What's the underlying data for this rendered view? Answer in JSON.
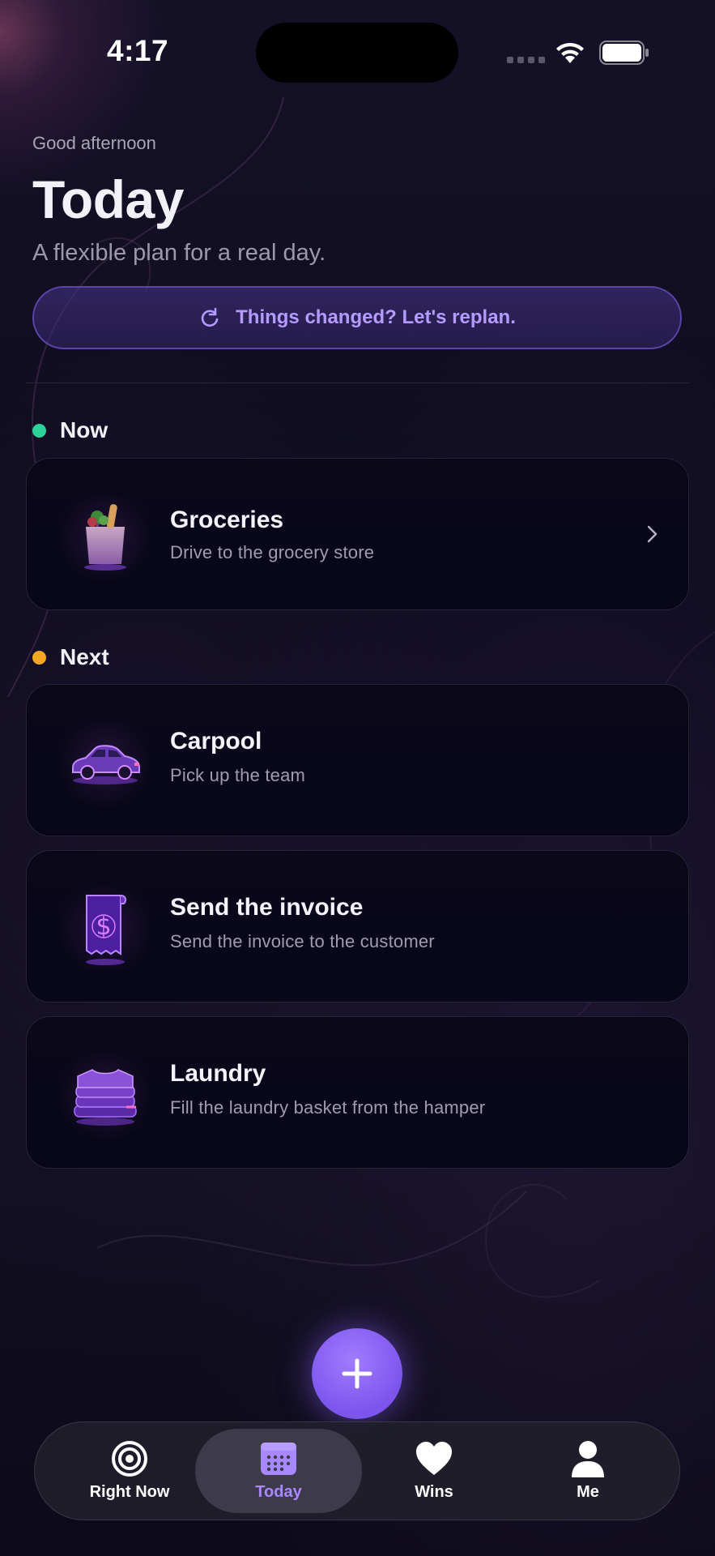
{
  "status_bar": {
    "time": "4:17"
  },
  "header": {
    "greeting": "Good afternoon",
    "title": "Today",
    "subtitle": "A flexible plan for a real day.",
    "replan_label": "Things changed? Let's replan."
  },
  "sections": {
    "now": {
      "label": "Now",
      "dot_color": "#2ed39b"
    },
    "next": {
      "label": "Next",
      "dot_color": "#f5a623"
    }
  },
  "tasks": [
    {
      "title": "Groceries",
      "description": "Drive to the grocery store",
      "icon": "grocery-bag-icon"
    },
    {
      "title": "Carpool",
      "description": "Pick up the team",
      "icon": "car-icon"
    },
    {
      "title": "Send the invoice",
      "description": "Send the invoice to the customer",
      "icon": "invoice-receipt-icon"
    },
    {
      "title": "Laundry",
      "description": "Fill the laundry basket from the hamper",
      "icon": "folded-clothes-icon"
    }
  ],
  "fab": {
    "icon": "plus-icon"
  },
  "tab_bar": {
    "active": "Today",
    "items": [
      {
        "label": "Right Now",
        "icon": "target-icon"
      },
      {
        "label": "Today",
        "icon": "calendar-icon"
      },
      {
        "label": "Wins",
        "icon": "heart-icon"
      },
      {
        "label": "Me",
        "icon": "person-icon"
      }
    ]
  },
  "colors": {
    "accent": "#a888ff",
    "background": "#0f0c20",
    "card": "#08071a"
  }
}
